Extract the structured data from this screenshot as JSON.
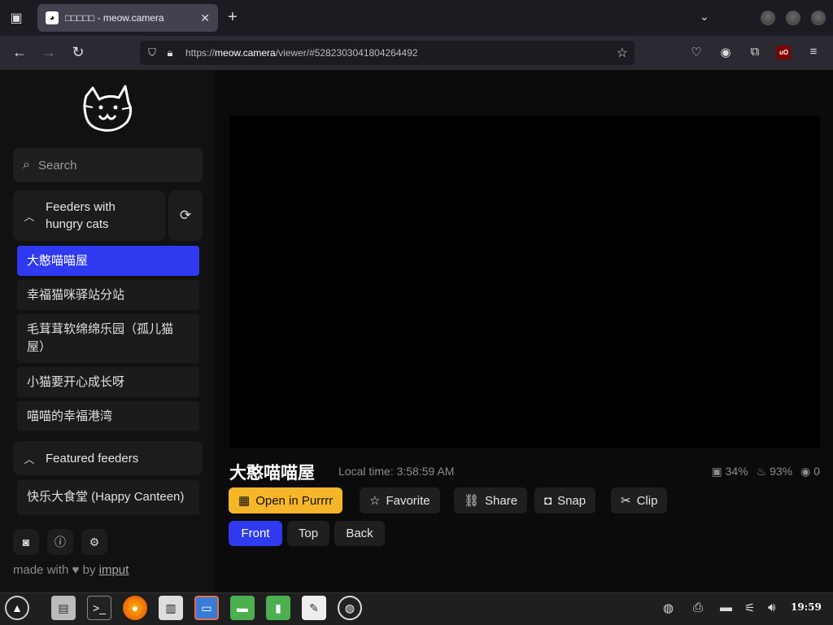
{
  "browser": {
    "tab_title": "□□□□□ - meow.camera",
    "url_prefix": "https://",
    "url_host": "meow.camera",
    "url_path": "/viewer/#5282303041804264492"
  },
  "sidebar": {
    "search_placeholder": "Search",
    "section_hungry": "Feeders with hungry cats",
    "feeders": [
      "大憨喵喵屋",
      "幸福猫咪驿站分站",
      "毛茸茸软绵绵乐园（孤儿猫屋）",
      "小猫要开心成长呀",
      "喵喵的幸福港湾"
    ],
    "section_featured": "Featured feeders",
    "featured": [
      "快乐大食堂 (Happy Canteen)"
    ],
    "made_with": "made with",
    "by": "by",
    "author": "imput"
  },
  "viewer": {
    "camera_title": "大憨喵喵屋",
    "local_time": "Local time: 3:58:59 AM",
    "food_level": "34%",
    "battery_level": "93%",
    "viewers": "0",
    "buttons": {
      "open": "Open in Purrrr",
      "favorite": "Favorite",
      "share": "Share",
      "snap": "Snap",
      "clip": "Clip"
    },
    "views": [
      "Front",
      "Top",
      "Back"
    ]
  },
  "taskbar": {
    "clock": "19:59"
  },
  "colors": {
    "accent": "#2f3af0",
    "purrrr": "#f5b629"
  }
}
